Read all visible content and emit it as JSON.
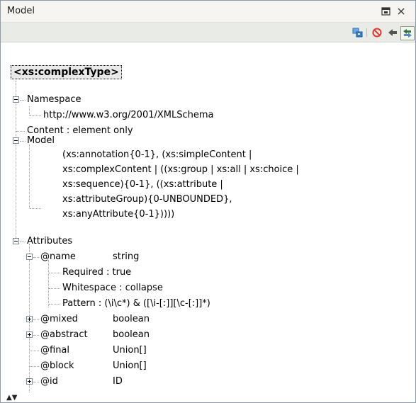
{
  "panel": {
    "title": "Model",
    "title_icons": [
      "maximize-icon",
      "close-icon"
    ]
  },
  "toolbar": {
    "icons": [
      "sync-with-editor-icon",
      "block-icon",
      "back-icon",
      "link-with-editor-icon"
    ],
    "colors": {
      "sync": "#2f7fd1",
      "block": "#e0392f",
      "back": "#555555",
      "link": "#2a7d2e"
    }
  },
  "tree": {
    "root": "<xs:complexType>",
    "namespace": {
      "label": "Namespace",
      "value": "http://www.w3.org/2001/XMLSchema"
    },
    "content": "Content : element only",
    "model": {
      "label": "Model",
      "lines": [
        "(xs:annotation{0-1}, (xs:simpleContent |",
        "xs:complexContent | ((xs:group | xs:all | xs:choice |",
        "xs:sequence){0-1}, ((xs:attribute |",
        "xs:attributeGroup){0-UNBOUNDED},",
        "xs:anyAttribute{0-1}))))"
      ]
    },
    "attributes": {
      "label": "Attributes",
      "items": [
        {
          "name": "@name",
          "type": "string",
          "expanded": true,
          "details": [
            "Required : true",
            "Whitespace : collapse",
            "Pattern : (\\i\\c*) & ([\\i-[:]][\\c-[:]]*)"
          ]
        },
        {
          "name": "@mixed",
          "type": "boolean",
          "expanded": false
        },
        {
          "name": "@abstract",
          "type": "boolean",
          "expanded": false
        },
        {
          "name": "@final",
          "type": "Union[]"
        },
        {
          "name": "@block",
          "type": "Union[]"
        },
        {
          "name": "@id",
          "type": "ID",
          "expanded": false
        }
      ]
    }
  }
}
